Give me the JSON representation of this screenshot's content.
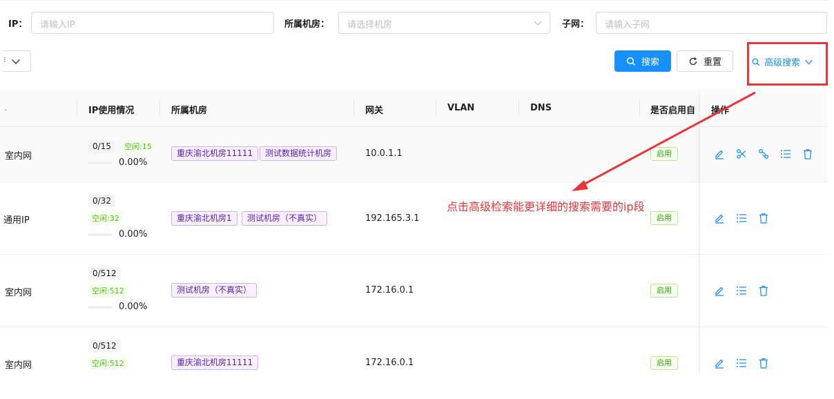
{
  "filters": {
    "ip_label": "IP：",
    "ip_placeholder": "请输入IP",
    "room_label": "所属机房：",
    "room_placeholder": "请选择机房",
    "subnet_label": "子网：",
    "subnet_placeholder": "请输入子网",
    "search_label": "搜索",
    "reset_label": "重置",
    "advanced_label": "高级搜索"
  },
  "table": {
    "columns": [
      "IP使用情况",
      "所属机房",
      "网关",
      "VLAN",
      "DNS",
      "是否启用自",
      "操作"
    ],
    "rows": [
      {
        "type": "室内网",
        "ratio": "0/15",
        "free": "空闲:15",
        "pct": "0.00%",
        "rooms": [
          "重庆渝北机房11111",
          "测试数据统计机房"
        ],
        "gateway": "10.0.1.1",
        "enabled": "启用"
      },
      {
        "type": "通用IP",
        "ratio": "0/32",
        "free": "空闲:32",
        "pct": "0.00%",
        "rooms": [
          "重庆渝北机房1",
          "测试机房（不真实）"
        ],
        "gateway": "192.165.3.1",
        "enabled": "启用"
      },
      {
        "type": "室内网",
        "ratio": "0/512",
        "free": "空闲:512",
        "pct": "0.00%",
        "rooms": [
          "测试机房（不真实）"
        ],
        "gateway": "172.16.0.1",
        "enabled": "启用"
      },
      {
        "type": "室内网",
        "ratio": "0/512",
        "free": "空闲:512",
        "pct": "",
        "rooms": [
          "重庆渝北机房11111"
        ],
        "gateway": "172.16.0.1",
        "enabled": "启用"
      }
    ]
  },
  "annotation": {
    "text": "点击高级检索能更详细的搜索需要的ip段"
  },
  "colors": {
    "primary": "#1890ff",
    "annotation_red": "#e8343a",
    "enabled_green": "#52c41a",
    "room_tag_purple": "#531dab"
  }
}
